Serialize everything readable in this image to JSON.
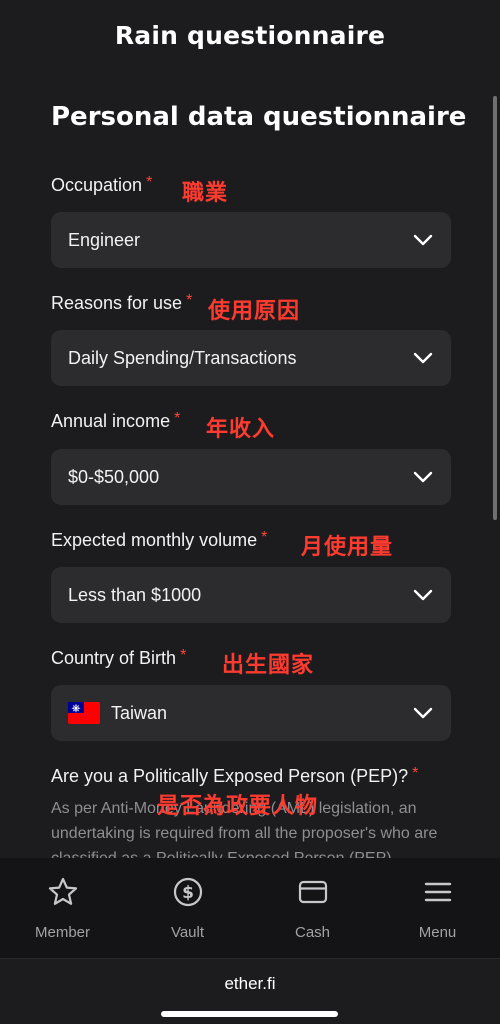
{
  "header": {
    "title": "Rain questionnaire"
  },
  "form": {
    "title": "Personal data questionnaire",
    "required_mark": "*",
    "fields": [
      {
        "label": "Occupation",
        "annotation": "職業",
        "value": "Engineer"
      },
      {
        "label": "Reasons for use",
        "annotation": "使用原因",
        "value": "Daily Spending/Transactions"
      },
      {
        "label": "Annual income",
        "annotation": "年收入",
        "value": "$0-$50,000"
      },
      {
        "label": "Expected monthly volume",
        "annotation": "月使用量",
        "value": "Less than $1000"
      },
      {
        "label": "Country of Birth",
        "annotation": "出生國家",
        "value": "Taiwan",
        "flag_icon": "taiwan-flag-icon"
      }
    ],
    "pep": {
      "question": "Are you a Politically Exposed Person (PEP)?",
      "annotation": "是否為政要人物",
      "description": "As per Anti-Money Laundering (AML) legislation, an undertaking is required from all the proposer's who are classified as a Politically Exposed Person (PEP)."
    }
  },
  "bottom_nav": {
    "items": [
      {
        "label": "Member",
        "icon": "star-icon"
      },
      {
        "label": "Vault",
        "icon": "dollar-coin-icon"
      },
      {
        "label": "Cash",
        "icon": "card-icon"
      },
      {
        "label": "Menu",
        "icon": "hamburger-menu-icon"
      }
    ]
  },
  "browser": {
    "url": "ether.fi"
  },
  "colors": {
    "background": "#1c1c1e",
    "field": "#2c2c2e",
    "required": "#ff453a",
    "annotation": "#ff3b30",
    "muted_text": "#8e8e93",
    "nav_background": "#141416"
  }
}
